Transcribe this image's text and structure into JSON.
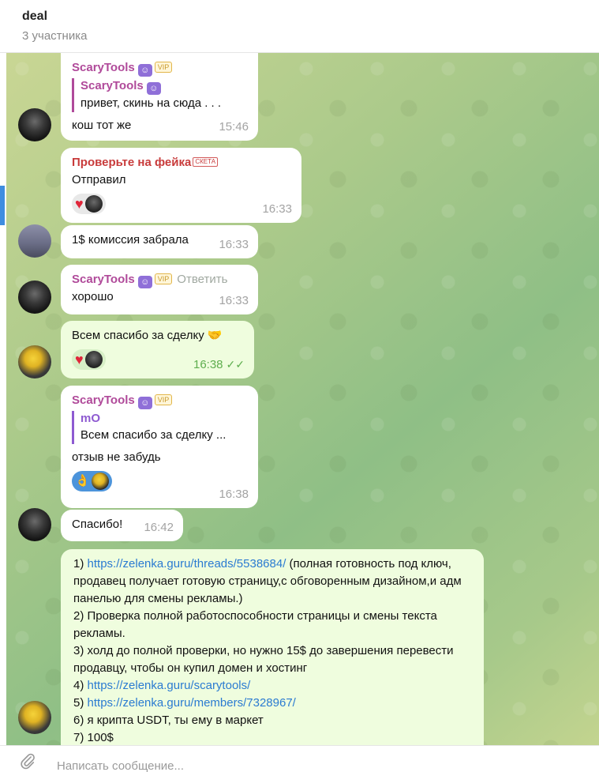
{
  "header": {
    "title": "deal",
    "subtitle": "3 участника"
  },
  "messages": {
    "m1": {
      "sender": "ScaryTools",
      "vip": "VIP",
      "quote_name": "ScaryTools",
      "quote_text": "привет, скинь на сюда . . .",
      "text": "кош тот же",
      "time": "15:46"
    },
    "m2": {
      "sender": "Проверьте на фейка",
      "scam": "СКЕТА",
      "text": "Отправил",
      "time": "16:33"
    },
    "m3": {
      "text": "1$ комиссия забрала",
      "time": "16:33"
    },
    "m4": {
      "sender": "ScaryTools",
      "vip": "VIP",
      "reply": "Ответить",
      "text": "хорошо",
      "time": "16:33"
    },
    "m5": {
      "text": "Всем спасибо за сделку 🤝",
      "time": "16:38"
    },
    "m6": {
      "sender": "ScaryTools",
      "vip": "VIP",
      "quote_name": "mO",
      "quote_text": "Всем спасибо за сделку ...",
      "text": "отзыв не забудь",
      "time": "16:38"
    },
    "m7": {
      "text": "Спасибо!",
      "time": "16:42"
    },
    "m8": {
      "l1_pre": "1) ",
      "l1_link": "https://zelenka.guru/threads/5538684/",
      "l1_post": " (полная готовность под ключ, продавец получает готовую страницу,с обговоренным дизайном,и адм панелью для смены рекламы.)",
      "l2": "2) Проверка полной работоспособности страницы и смены текста рекламы.",
      "l3": "3) холд до полной проверки, но нужно 15$ до завершения перевести продавцу, чтобы он купил домен и хостинг",
      "l4_pre": "4) ",
      "l4_link": "https://zelenka.guru/scarytools/",
      "l5_pre": "5) ",
      "l5_link": "https://zelenka.guru/members/7328967/",
      "l6": "6) я крипта USDT, ты ему в маркет",
      "l7": "7) 100$"
    }
  },
  "composer": {
    "placeholder": "Написать сообщение..."
  },
  "icons": {
    "badge": "robot-badge-icon",
    "heart": "heart-icon",
    "ok": "ok-hand-icon",
    "attach": "paperclip-icon"
  }
}
